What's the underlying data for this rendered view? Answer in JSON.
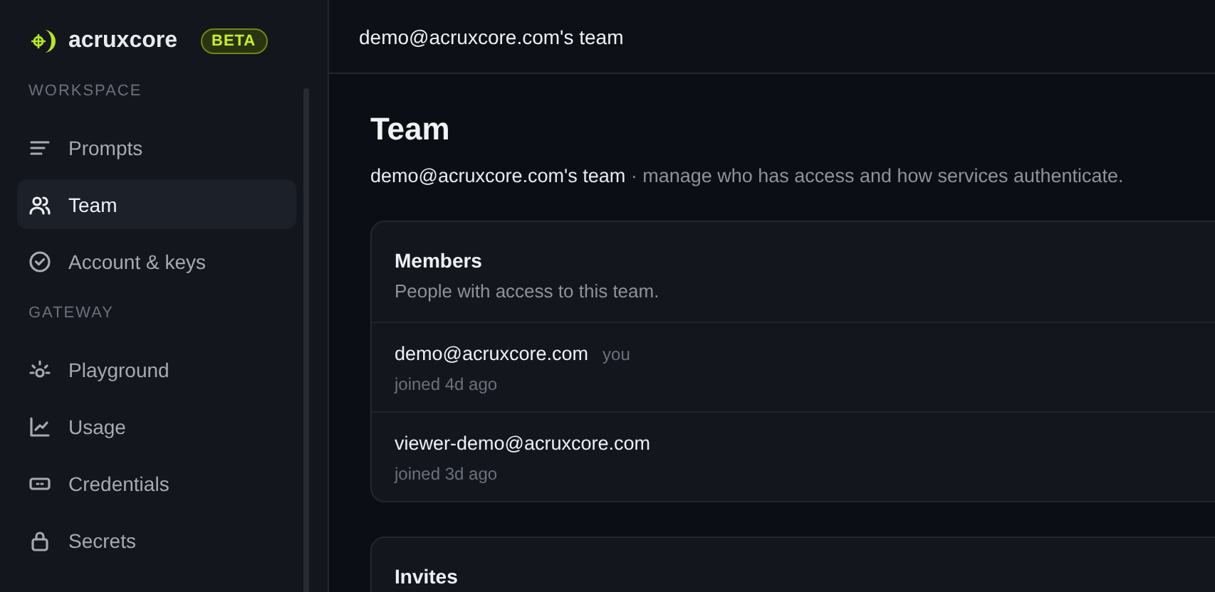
{
  "brand": {
    "name": "acruxcore",
    "badge": "BETA"
  },
  "sidebar": {
    "sections": [
      {
        "title": "WORKSPACE",
        "items": [
          {
            "label": "Prompts",
            "kind": "lines",
            "selected": false
          },
          {
            "label": "Team",
            "kind": "users",
            "selected": true
          },
          {
            "label": "Account & keys",
            "kind": "check",
            "selected": false
          }
        ]
      },
      {
        "title": "GATEWAY",
        "items": [
          {
            "label": "Playground",
            "kind": "bulb",
            "selected": false
          },
          {
            "label": "Usage",
            "kind": "chart",
            "selected": false
          },
          {
            "label": "Credentials",
            "kind": "card",
            "selected": false
          },
          {
            "label": "Secrets",
            "kind": "lock",
            "selected": false
          }
        ]
      }
    ]
  },
  "topbar": {
    "title": "demo@acruxcore.com's team"
  },
  "page": {
    "title": "Team",
    "team": "demo@acruxcore.com's team",
    "subtitle": "· manage who has access and how services authenticate."
  },
  "members": {
    "title": "Members",
    "description": "People with access to this team.",
    "rows": [
      {
        "email": "demo@acruxcore.com",
        "tag": "you",
        "joined": "joined 4d ago"
      },
      {
        "email": "viewer-demo@acruxcore.com",
        "joined": "joined 3d ago"
      }
    ]
  },
  "invites": {
    "title": "Invites"
  }
}
